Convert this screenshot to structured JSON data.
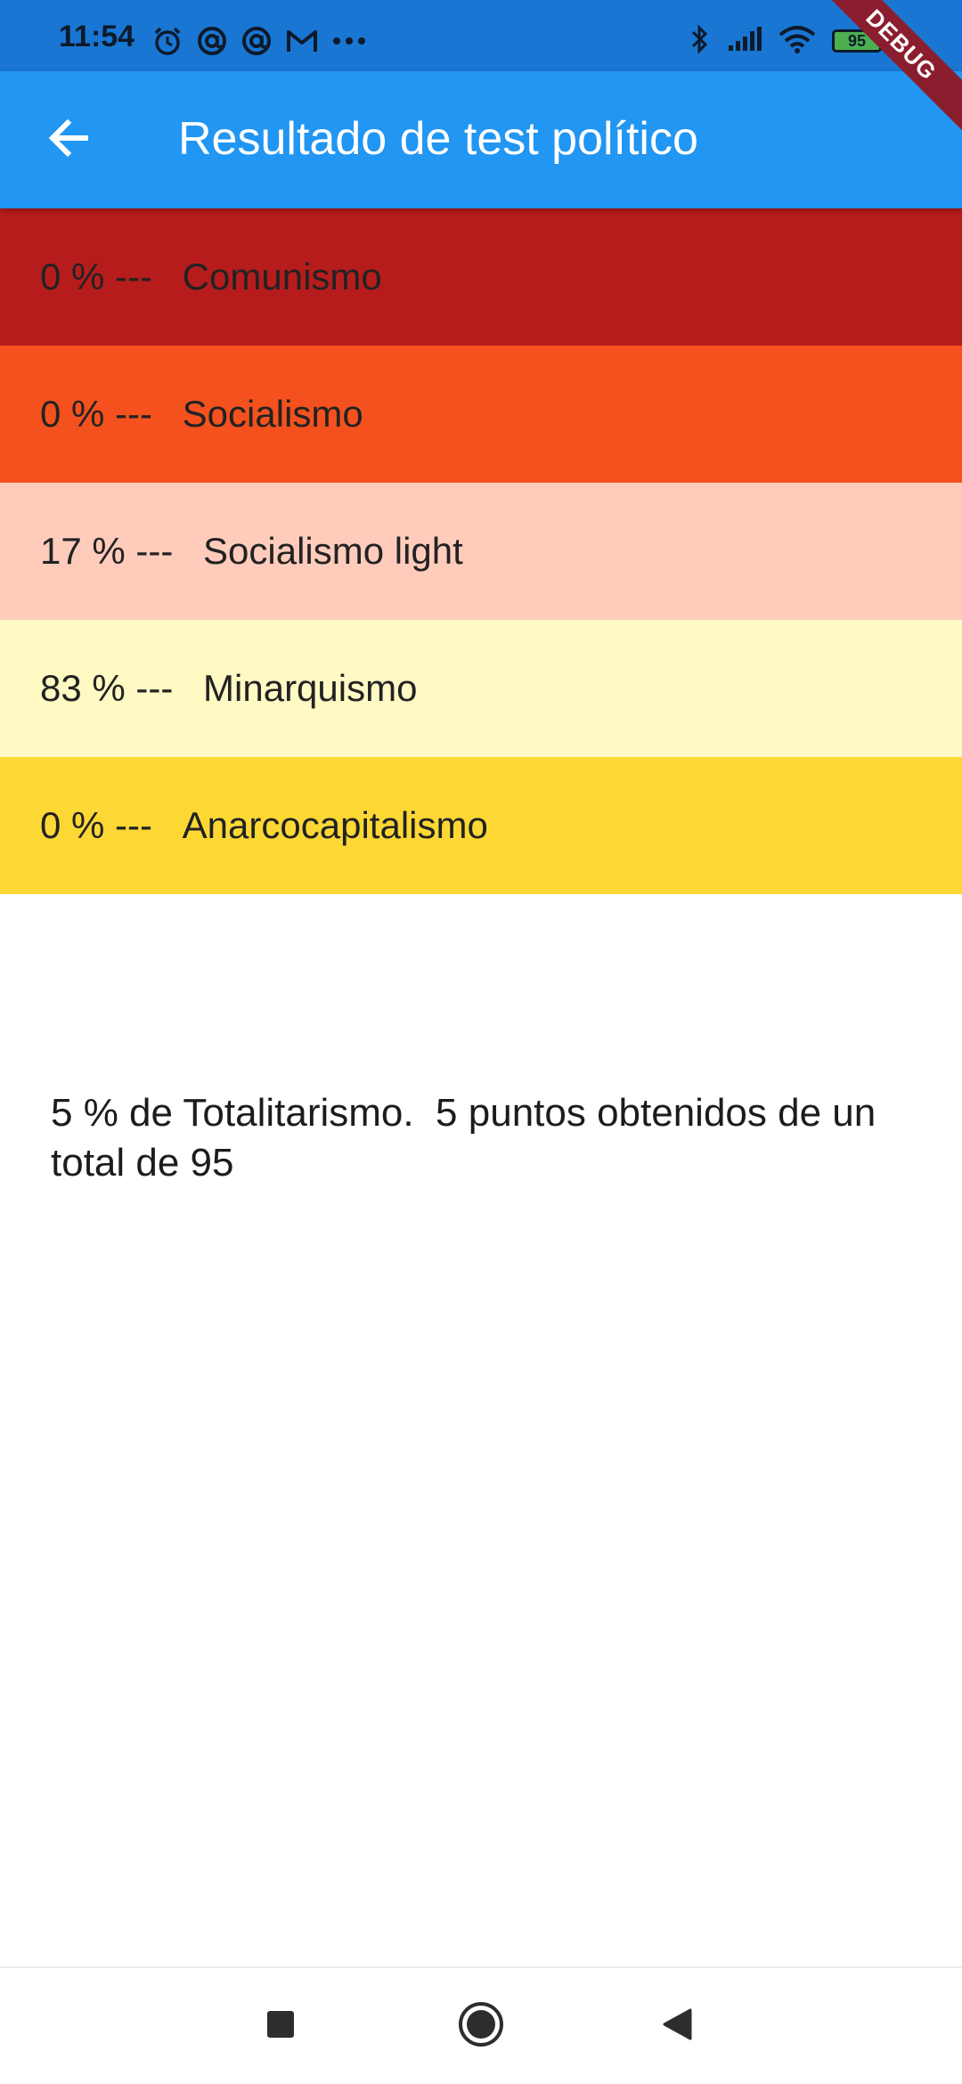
{
  "status_bar": {
    "time": "11:54",
    "battery_level": "95",
    "left_icons": [
      "alarm-icon",
      "at-icon",
      "at-icon",
      "gmail-icon",
      "more-dots-icon"
    ],
    "right_icons": [
      "bluetooth-icon",
      "signal-icon",
      "wifi-icon",
      "battery-icon"
    ],
    "background_color": "#1976D2"
  },
  "debug_banner": "DEBUG",
  "app_bar": {
    "title": "Resultado de test político",
    "back_icon": "arrow-back-icon",
    "background_color": "#2196F3"
  },
  "results": [
    {
      "percent": "0 %",
      "separator": " --- ",
      "label": "Comunismo",
      "color": "#B71C1C"
    },
    {
      "percent": "0 %",
      "separator": " --- ",
      "label": "Socialismo",
      "color": "#F4511E"
    },
    {
      "percent": "17 %",
      "separator": " --- ",
      "label": "Socialismo light",
      "color": "#FFCCBC"
    },
    {
      "percent": "83 %",
      "separator": " --- ",
      "label": "Minarquismo",
      "color": "#FFF9C4"
    },
    {
      "percent": "0 %",
      "separator": " --- ",
      "label": "Anarcocapitalismo",
      "color": "#FDD835"
    }
  ],
  "summary": "5 % de Totalitarismo.  5 puntos obtenidos de un total de 95",
  "nav_bar": {
    "buttons": [
      "recents-square-icon",
      "home-circle-icon",
      "back-triangle-icon"
    ]
  }
}
